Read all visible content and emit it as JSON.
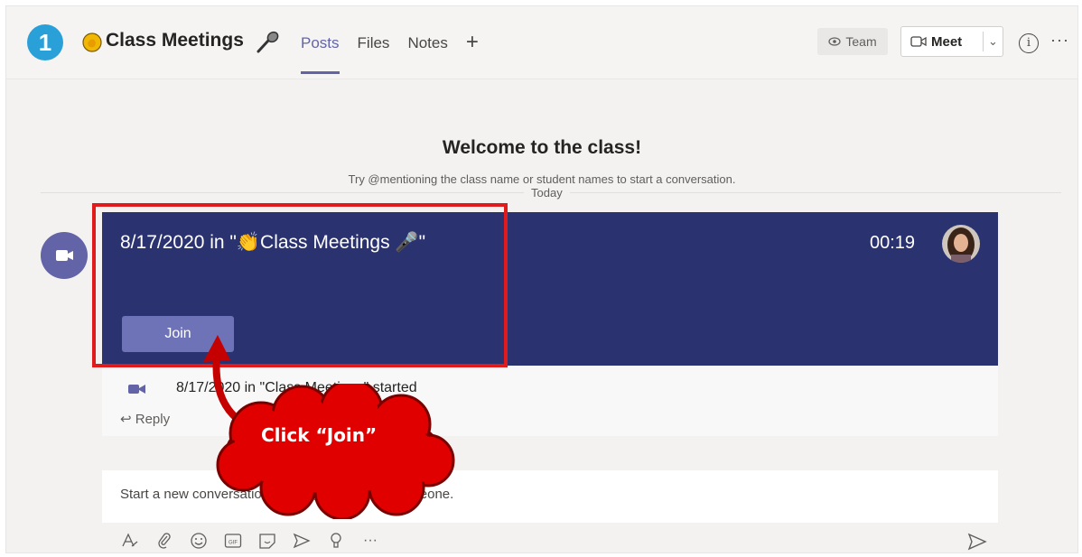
{
  "header": {
    "step_number": "1",
    "channel_title": "Class Meetings",
    "tabs": [
      {
        "label": "Posts",
        "active": true
      },
      {
        "label": "Files",
        "active": false
      },
      {
        "label": "Notes",
        "active": false
      }
    ],
    "add_tab_icon": "+",
    "team_button": "Team",
    "meet_button": "Meet",
    "meet_dropdown_icon": "chevron-down-icon",
    "info_icon": "info-icon",
    "more_icon": "more-icon"
  },
  "welcome": {
    "title": "Welcome to the class!",
    "subtitle": "Try @mentioning the class name or student names to start a conversation.",
    "date_divider": "Today"
  },
  "meeting_card": {
    "title": "8/17/2020 in \"👏Class Meetings 🎤\"",
    "duration": "00:19",
    "join_label": "Join",
    "started_text": "8/17/2020 in \"Class Meetings\" started",
    "reply_label": "Reply"
  },
  "callout": {
    "text": "Click “Join”"
  },
  "compose": {
    "placeholder": "Start a new conversation. Type @ to mention someone.",
    "tools": [
      "format-icon",
      "attach-icon",
      "emoji-icon",
      "gif-icon",
      "sticker-icon",
      "meet-now-icon",
      "praise-icon",
      "more-options-icon"
    ],
    "send_icon": "send-icon"
  },
  "colors": {
    "accent": "#6264a7",
    "card_bg": "#2b3270",
    "highlight": "#e11b1b",
    "callout": "#e00000",
    "step_badge": "#2aa0d8"
  }
}
